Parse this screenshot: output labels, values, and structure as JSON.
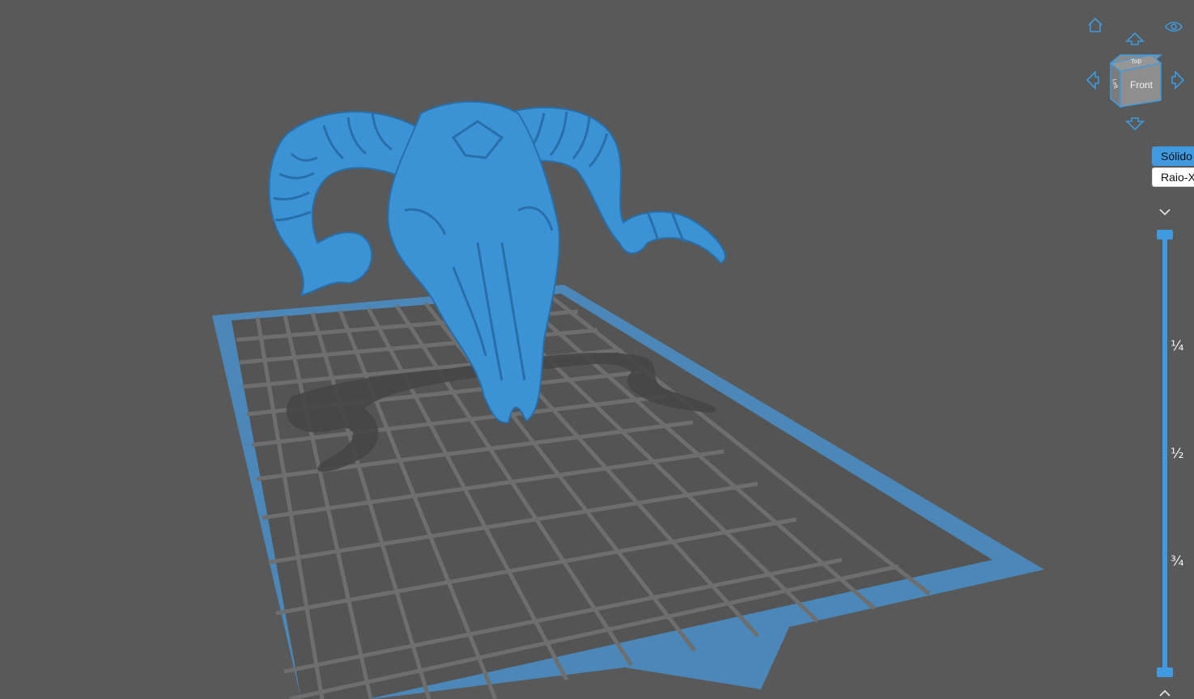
{
  "viewport": {
    "background": "#595959",
    "bed_color": "#4b87b8",
    "grid_color": "#6c6c6c",
    "model_color": "#3b93d6"
  },
  "nav": {
    "home_icon": "home-icon",
    "visibility_icon": "eye-icon",
    "rotate_up_icon": "arrow-up-icon",
    "rotate_down_icon": "arrow-down-icon",
    "rotate_left_icon": "arrow-left-icon",
    "rotate_right_icon": "arrow-right-icon"
  },
  "view_cube": {
    "front": "Front",
    "top": "Top",
    "left": "Left"
  },
  "render_mode": {
    "solid_label": "Sólido",
    "xray_label": "Raio-X",
    "selected": "Sólido",
    "accent": "#3f9ae0"
  },
  "layer_slider": {
    "ticks": [
      "¼",
      "½",
      "¾"
    ],
    "collapse_icon": "chevron-down-icon",
    "expand_icon": "chevron-up-icon"
  }
}
